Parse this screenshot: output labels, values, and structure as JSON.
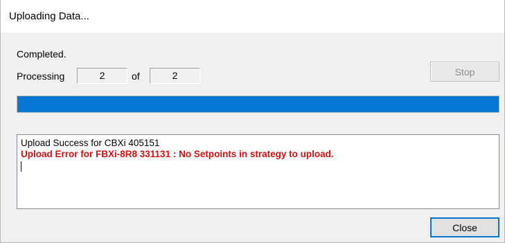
{
  "window": {
    "title": "Uploading Data..."
  },
  "status": {
    "text": "Completed.",
    "processing_label": "Processing",
    "current": "2",
    "of_label": "of",
    "total": "2"
  },
  "buttons": {
    "stop_label": "Stop",
    "close_label": "Close"
  },
  "progress": {
    "percent": 100,
    "fill_color": "#0678d4"
  },
  "log": {
    "lines": [
      {
        "text": "Upload Success for CBXi 405151",
        "type": "success"
      },
      {
        "text": "Upload Error for FBXi-8R8  331131 : No Setpoints in strategy to upload.",
        "type": "error"
      }
    ],
    "error_color": "#cc1111"
  }
}
